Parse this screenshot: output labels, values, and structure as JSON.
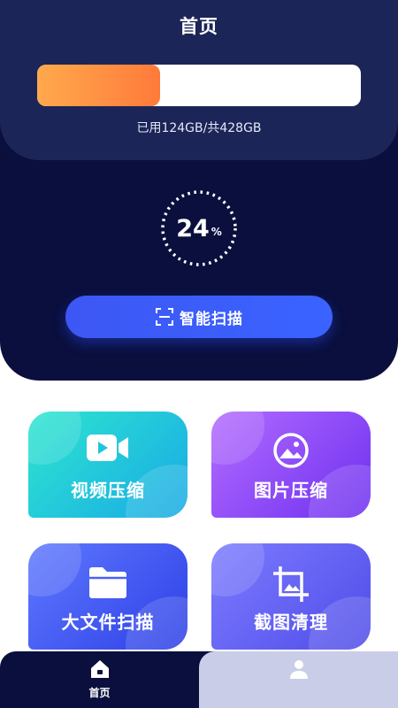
{
  "header": {
    "title": "首页"
  },
  "storage": {
    "used_fraction": 0.38,
    "text": "已用124GB/共428GB"
  },
  "gauge": {
    "value": "24",
    "unit": "%"
  },
  "scan_button": {
    "label": "智能扫描",
    "icon": "scan-icon"
  },
  "tiles": [
    {
      "label": "视频压缩",
      "icon": "video-camera-icon"
    },
    {
      "label": "图片压缩",
      "icon": "image-icon"
    },
    {
      "label": "大文件扫描",
      "icon": "folder-icon"
    },
    {
      "label": "截图清理",
      "icon": "crop-image-icon"
    }
  ],
  "bottom_nav": {
    "items": [
      {
        "label": "首页",
        "icon": "home-icon",
        "active": true
      },
      {
        "label": "",
        "icon": "user-icon",
        "active": false
      }
    ]
  },
  "colors": {
    "hero_bg": "#0a0f3d",
    "storage_card_bg": "#1c2558",
    "storage_fill": "#ff8a3d",
    "scan_button": "#3d57f4"
  }
}
